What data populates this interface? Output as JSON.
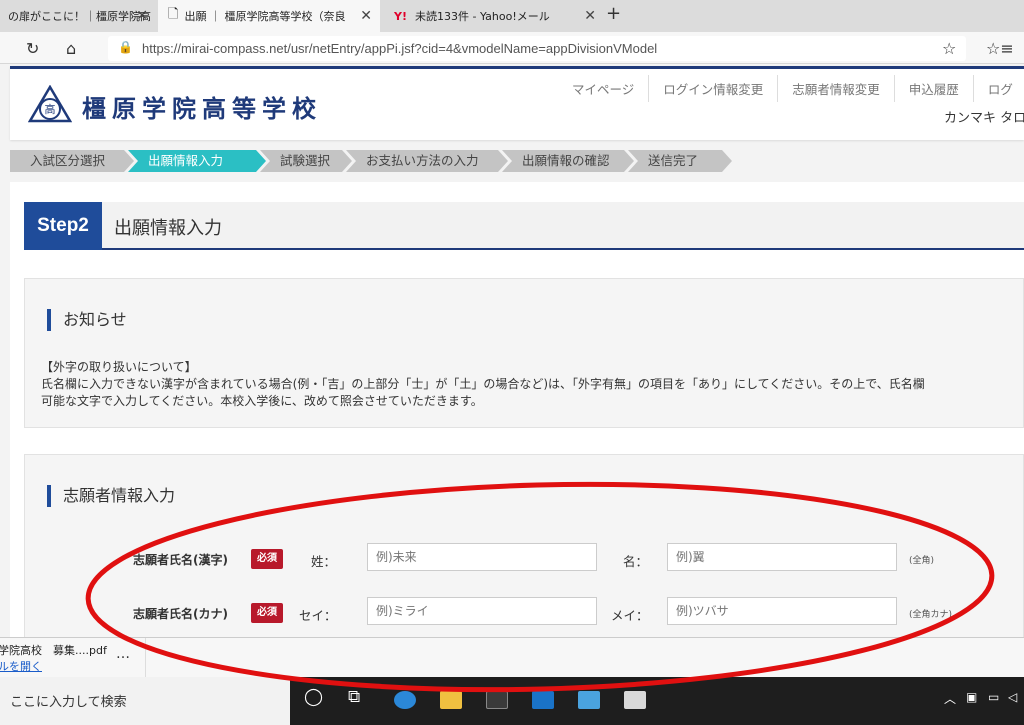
{
  "browser": {
    "tabs": [
      {
        "title": "の扉がここに！｜橿原学院高"
      },
      {
        "title": "出願 ｜ 橿原学院高等学校（奈良"
      },
      {
        "title": "未読133件 - Yahoo!メール"
      }
    ],
    "url": "https://mirai-compass.net/usr/netEntry/appPi.jsf?cid=4&vmodelName=appDivisionVModel"
  },
  "site": {
    "school_name": "橿原学院高等学校",
    "logo_text": "高",
    "nav": [
      "マイページ",
      "ログイン情報変更",
      "志願者情報変更",
      "申込履歴",
      "ログ"
    ],
    "username": "カンマキ タロ"
  },
  "steps": [
    "入試区分選択",
    "出願情報入力",
    "試験選択",
    "お支払い方法の入力",
    "出願情報の確認",
    "送信完了"
  ],
  "step_header": {
    "badge": "Step2",
    "title": "出願情報入力"
  },
  "notice": {
    "title": "お知らせ",
    "lines": [
      "【外字の取り扱いについて】",
      "氏名欄に入力できない漢字が含まれている場合(例・「吉」の上部分「士」が「土」の場合など)は、「外字有無」の項目を「あり」にしてください。その上で、氏名欄",
      "可能な文字で入力してください。本校入学後に、改めて照会させていただきます。"
    ]
  },
  "applicant": {
    "title": "志願者情報入力",
    "required": "必須",
    "kanji": {
      "label": "志願者氏名(漢字)",
      "last_label": "姓：",
      "last_placeholder": "例)未来",
      "first_label": "名：",
      "first_placeholder": "例)翼",
      "hint": "(全角)"
    },
    "kana": {
      "label": "志願者氏名(カナ)",
      "last_label": "セイ：",
      "last_placeholder": "例)ミライ",
      "first_label": "メイ：",
      "first_placeholder": "例)ツバサ",
      "hint": "(全角カナ)"
    }
  },
  "download": {
    "name": "学院高校　募集....pdf",
    "link": "ルを開く",
    "more": "…"
  },
  "taskbar": {
    "search": "ここに入力して検索"
  },
  "colors": {
    "brand": "#1f3a7a",
    "step_active": "#2bbfc4",
    "required": "#b8192b",
    "annotation": "#e01010"
  }
}
